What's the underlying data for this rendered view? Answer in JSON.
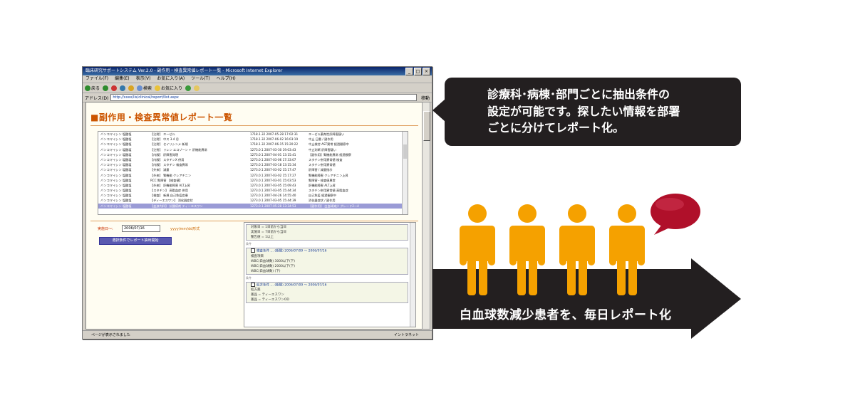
{
  "window": {
    "title": "臨床研究サポートシステム Ver.2.0 - 副作用・検査異常値レポート一覧 - Microsoft Internet Explorer",
    "menu": [
      "ファイル(F)",
      "編集(E)",
      "表示(V)",
      "お気に入り(A)",
      "ツール(T)",
      "ヘルプ(H)"
    ],
    "toolbar": {
      "back": "戻る",
      "search": "検索",
      "favorites": "お気に入り"
    },
    "address_label": "アドレス(D)",
    "address": "http://xxxx/lis/clinical/report/list.aspx",
    "go_label": "移動",
    "status": "ページが表示されました",
    "zone": "イントラネット"
  },
  "page": {
    "title": "副作用・検査異常値レポート一覧",
    "report_rows": [
      [
        "バンコマイシン 塩酸塩",
        "【注射】 エーゼル",
        "1718.1.32 2007-05-28 17:02:31",
        "エーゼル薬剤性肝障害疑い"
      ],
      [
        "バンコマイシン 塩酸塩",
        "【注射】 中ス 3.4 月",
        "1718.1.32 2007-06-02 16:03:19",
        "中止 日番 / 副作用"
      ],
      [
        "バンコマイシン 塩酸塩",
        "【注射】 セイリシンメ 新規",
        "1718.1.32 2007-06-15 15:20:22",
        "中止検討 AST異常 経過観察中"
      ],
      [
        "バンコマイシン 塩酸塩",
        "【注射】 リレン エコゾーン + 肝機能異常",
        "1273.0.1 2007-03-30 19:03:43",
        "中止判断 肝障害疑い"
      ],
      [
        "バンコマイシン 塩酸塩",
        "【内服】 肝障害発現",
        "1273.0.1 2007-04-01 13:15:41",
        "【副作用】腎機能異常 経過観察"
      ],
      [
        "バンコマイシン 塩酸塩",
        "【内服】 スタチンX 併用",
        "1273.0.1 2007-03-06 17:33:07",
        "スタチン併用異常値 検査"
      ],
      [
        "バンコマイシン 塩酸塩",
        "【内服】 スタチン 検査異常",
        "1273.0.1 2007-03-18 13:15:34",
        "スタチン併用異常値"
      ],
      [
        "バンコマイシン 塩酸塩",
        "【外来】 減量",
        "1273.0.1 2007-03-02 15:17:47",
        "肝障害 / 減量指示"
      ],
      [
        "バンコマイシン 塩酸塩",
        "【外来】 腎機能 クレアチニン",
        "1273.0.1 2007-03-02 15:17:27",
        "腎機能障害 クレアチニン上昇"
      ],
      [
        "バンコマイシン 塩酸塩",
        "RCC 腎障害 【検査値】",
        "1273.0.1 2007-03-01 15:03:53",
        "腎障害・検査値異常"
      ],
      [
        "バンコマイシン 塩酸塩",
        "【外来】 肝機能障害 ALT上昇",
        "1273.0.1 2007-03-05 15:09:43",
        "肝機能障害 ALT上昇"
      ],
      [
        "バンコマイシン 塩酸塩",
        "【スタチン】 高脂血症 併用",
        "1273.0.1 2007-03-05 15:44:34",
        "スタチン併用異常値 高脂血症"
      ],
      [
        "バンコマイシン 塩酸塩",
        "【検査】 新規 自己免疫疾患",
        "1273.0.1 2007-04-26 14:55:40",
        "自己免疫 経過観察中"
      ],
      [
        "バンコマイシン 塩酸塩",
        "【ディーエスワン】 消化器症状",
        "1273.0.1 2007-03-05 15:44:39",
        "消化器症状 / 副作用"
      ],
      [
        "バンコマイシン 塩酸塩",
        "【血液内科】 抗腫瘍剤 ティーエスワン",
        "1273.0.1 2007-05-28 13:34:53",
        "【副作用】 白血球減少 グレード2～4"
      ]
    ],
    "date_label": "実施日～:",
    "date_value": "2006/07/16",
    "date_note": "yyyy/mm/dd形式",
    "launch_button": "選択条件でレポート抽出開始",
    "conditions": [
      {
        "lines": [
          "対象日 = 1日前から当日",
          "実施日 = 7日前から当日",
          "警告値 = 1以上"
        ],
        "label": ""
      },
      {
        "lines": [
          "検査条件 … (期間) 2006/07/09 ～ 2006/07/16",
          "検査項目",
          "WBC(白血球数) 3000以下(下)",
          "WBC(白血球数) 2000以下(下)",
          "WBC(白血球数) (下)"
        ],
        "label": "条件"
      },
      {
        "lines": [
          "処方条件 … (期間) 2006/07/09 ～ 2006/07/16",
          "処方薬",
          "薬品 = ティーエスワン",
          "薬品 = ティーエスワンOD"
        ],
        "label": "条件"
      }
    ]
  },
  "callout": {
    "lines": [
      "診療科･病棟･部門ごとに抽出条件の",
      "設定が可能です。探したい情報を部署",
      "ごとに分けてレポート化。"
    ]
  },
  "arrow": {
    "label": "白血球数減少患者を、毎日レポート化",
    "color": "#231f20"
  },
  "people": {
    "count": 4,
    "color": "#f5a100",
    "bubble_color": "#b0102a"
  }
}
